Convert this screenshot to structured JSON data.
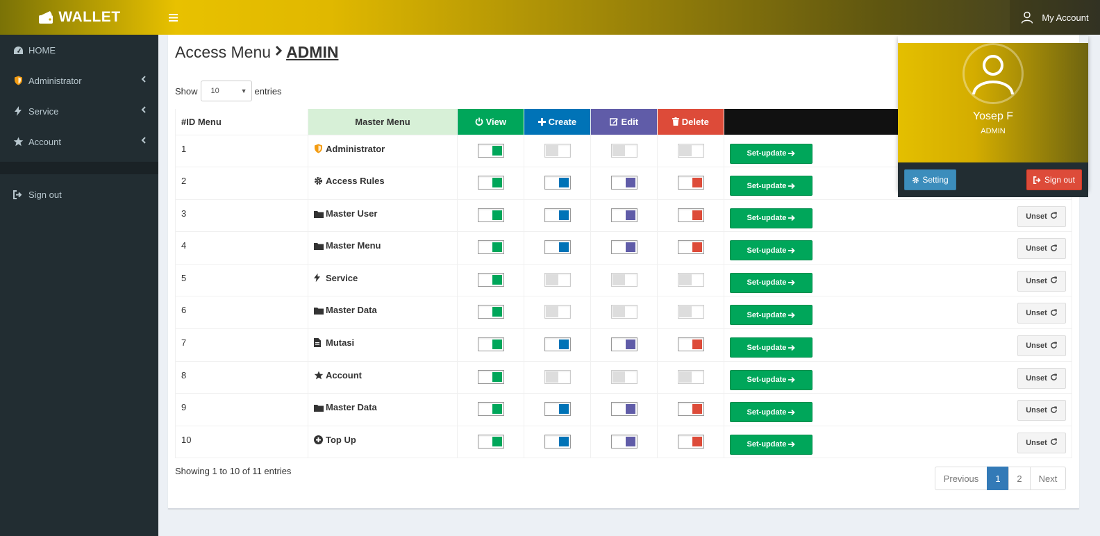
{
  "header": {
    "brand": "WALLET",
    "menu_icon": "bars-icon",
    "account_label": "My Account"
  },
  "sidebar": {
    "items": [
      {
        "label": "HOME",
        "icon": "dashboard-icon"
      },
      {
        "label": "Administrator",
        "icon": "shield-icon"
      },
      {
        "label": "Service",
        "icon": "bolt-icon"
      },
      {
        "label": "Account",
        "icon": "star-icon"
      },
      {
        "label": "Sign out",
        "icon": "sign-out-icon"
      }
    ]
  },
  "page": {
    "title": "Access Menu",
    "role": "ADMIN"
  },
  "length": {
    "show": "Show",
    "value": "10",
    "entries": "entries"
  },
  "table": {
    "headers": {
      "id": "#ID Menu",
      "master": "Master Menu",
      "view": "View",
      "create": "Create",
      "edit": "Edit",
      "delete": "Delete"
    },
    "set_label": "Set-update",
    "unset_label": "Unset",
    "rows": [
      {
        "id": "1",
        "menu": "Administrator",
        "icon": "shield-icon",
        "view": true,
        "create": false,
        "edit": false,
        "delete": false
      },
      {
        "id": "2",
        "menu": "Access Rules",
        "icon": "gear-icon",
        "view": true,
        "create": true,
        "edit": true,
        "delete": true
      },
      {
        "id": "3",
        "menu": "Master User",
        "icon": "folder-icon",
        "view": true,
        "create": true,
        "edit": true,
        "delete": true
      },
      {
        "id": "4",
        "menu": "Master Menu",
        "icon": "folder-icon",
        "view": true,
        "create": true,
        "edit": true,
        "delete": true
      },
      {
        "id": "5",
        "menu": "Service",
        "icon": "bolt-icon",
        "view": true,
        "create": false,
        "edit": false,
        "delete": false
      },
      {
        "id": "6",
        "menu": "Master Data",
        "icon": "folder-icon",
        "view": true,
        "create": false,
        "edit": false,
        "delete": false
      },
      {
        "id": "7",
        "menu": "Mutasi",
        "icon": "file-icon",
        "view": true,
        "create": true,
        "edit": true,
        "delete": true
      },
      {
        "id": "8",
        "menu": "Account",
        "icon": "star-icon",
        "view": true,
        "create": false,
        "edit": false,
        "delete": false
      },
      {
        "id": "9",
        "menu": "Master Data",
        "icon": "folder-icon",
        "view": true,
        "create": true,
        "edit": true,
        "delete": true
      },
      {
        "id": "10",
        "menu": "Top Up",
        "icon": "plus-circle-icon",
        "view": true,
        "create": true,
        "edit": true,
        "delete": true
      }
    ]
  },
  "footer": {
    "info": "Showing 1 to 10 of 11 entries",
    "prev": "Previous",
    "page1": "1",
    "page2": "2",
    "next": "Next"
  },
  "user": {
    "name": "Yosep F",
    "role": "ADMIN",
    "setting": "Setting",
    "signout": "Sign out"
  },
  "colors": {
    "view": "#00a65a",
    "create": "#0073b7",
    "edit": "#605ca8",
    "delete": "#dd4b39",
    "brand": "#e0b800",
    "sidebar": "#222d32"
  }
}
